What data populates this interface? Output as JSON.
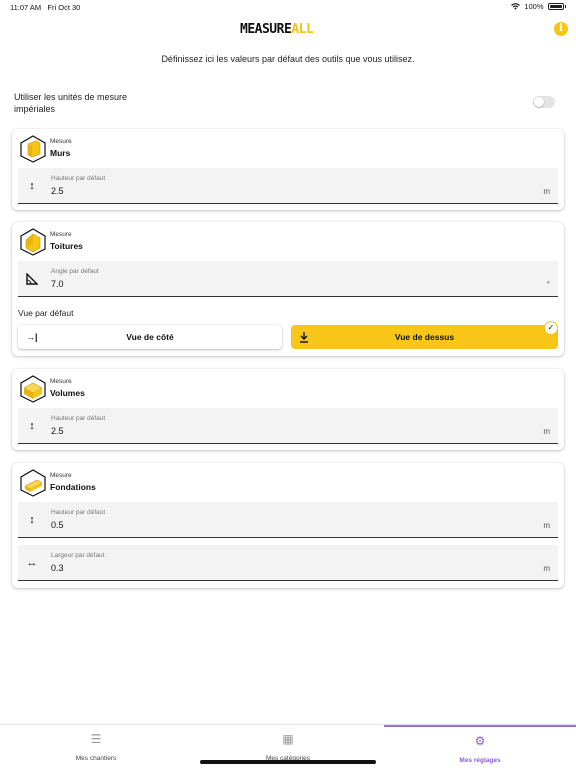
{
  "status": {
    "time": "11:07 AM",
    "date": "Fri Oct 30",
    "battery": "100%"
  },
  "header": {
    "logo_part1": "MEASURE",
    "logo_part2": "ALL",
    "info_glyph": "i"
  },
  "intro_text": "Définissez ici les valeurs par défaut des outils que vous utilisez.",
  "imperial": {
    "label": "Utiliser les unités de mesure impériales",
    "enabled": false
  },
  "cards": {
    "walls": {
      "kicker": "Mesure",
      "title": "Murs",
      "icon": "wall-cube-icon",
      "height": {
        "label": "Hauteur par défaut",
        "value": "2.5",
        "unit": "m",
        "icon": "vertical-arrows-icon"
      }
    },
    "roofs": {
      "kicker": "Mesure",
      "title": "Toitures",
      "icon": "roof-cube-icon",
      "angle": {
        "label": "Angle par défaut",
        "value": "7.0",
        "unit": "°",
        "icon": "angle-icon"
      },
      "view_label": "Vue par défaut",
      "view_side": "Vue de côté",
      "view_top": "Vue de dessus",
      "selected_view": "Vue de dessus"
    },
    "volumes": {
      "kicker": "Mesure",
      "title": "Volumes",
      "icon": "volume-cube-icon",
      "height": {
        "label": "Hauteur par défaut",
        "value": "2.5",
        "unit": "m",
        "icon": "vertical-arrows-icon"
      }
    },
    "foundations": {
      "kicker": "Mesure",
      "title": "Fondations",
      "icon": "foundation-cube-icon",
      "height": {
        "label": "Hauteur par défaut",
        "value": "0.5",
        "unit": "m",
        "icon": "vertical-arrows-icon"
      },
      "width": {
        "label": "Largeur par défaut",
        "value": "0.3",
        "unit": "m",
        "icon": "horizontal-arrows-icon"
      }
    }
  },
  "tabs": [
    {
      "label": "Mes chantiers",
      "icon": "list-icon",
      "active": false
    },
    {
      "label": "Mes catégories",
      "icon": "grid-icon",
      "active": false
    },
    {
      "label": "Mes réglages",
      "icon": "gear-icon",
      "active": true
    }
  ],
  "colors": {
    "accent": "#f7c619",
    "tab_active": "#8b5cd1"
  }
}
